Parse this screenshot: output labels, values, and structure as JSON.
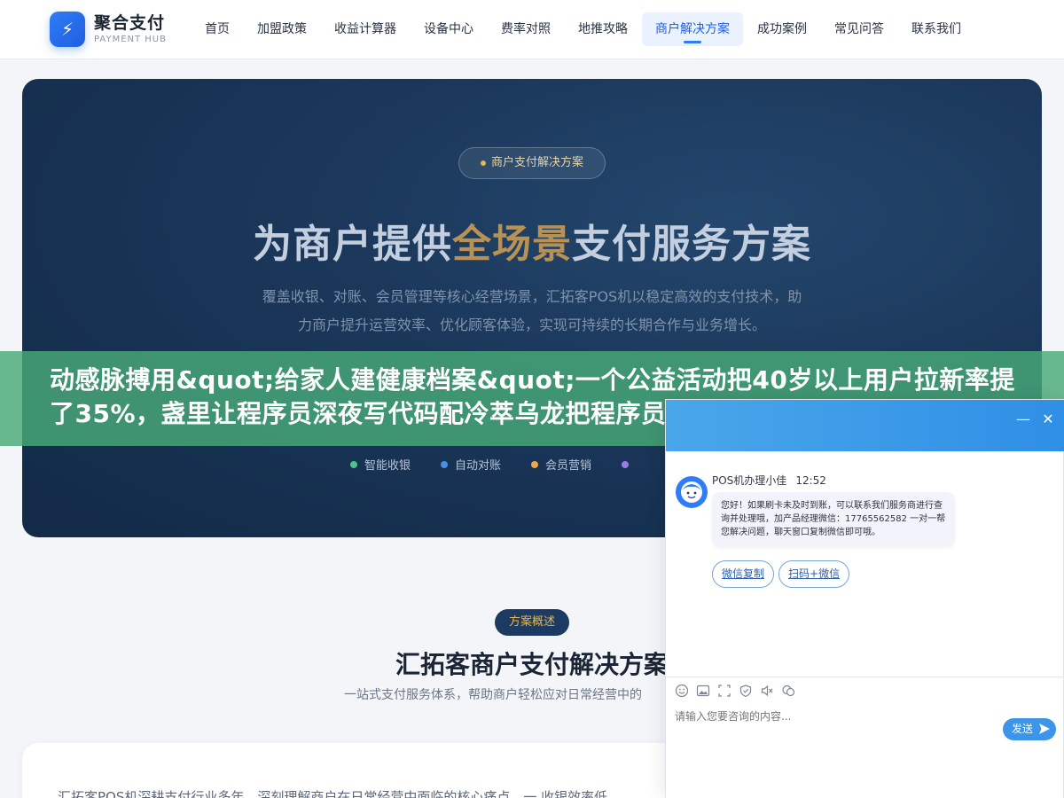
{
  "header": {
    "logo_title": "聚合支付",
    "logo_sub": "PAYMENT HUB",
    "nav": [
      "首页",
      "加盟政策",
      "收益计算器",
      "设备中心",
      "费率对照",
      "地推攻略",
      "商户解决方案",
      "成功案例",
      "常见问答",
      "联系我们"
    ],
    "active_index": 6
  },
  "hero": {
    "badge": "商户支付解决方案",
    "title_pre": "为商户提供",
    "title_highlight": "全场景",
    "title_post": "支付服务方案",
    "desc": "覆盖收银、对账、会员管理等核心经营场景，汇拓客POS机以稳定高效的支付技术，助力商户提升运营效率、优化顾客体验，实现可持续的长期合作与业务增长。",
    "tags": [
      {
        "label": "智能收银",
        "color": "#4cc38a"
      },
      {
        "label": "自动对账",
        "color": "#4a90e2"
      },
      {
        "label": "会员营销",
        "color": "#f0a54a"
      },
      {
        "label": "",
        "color": "#9b7be6"
      }
    ]
  },
  "overlay_banner": {
    "text": "动感脉搏用&quot;给家人建健康档案&quot;一个公益活动把40岁以上用户拉新率提了35%，盏里让程序员深夜写代码配冷萃乌龙把程序员套装销"
  },
  "section": {
    "pill": "方案概述",
    "title": "汇拓客商户支付解决方案",
    "subtitle": "一站式支付服务体系，帮助商户轻松应对日常经营中的",
    "content_text": "汇拓客POS机深耕支付行业多年，深刻理解商户在日常经营中面临的核心痛点，一 收银效率低"
  },
  "chat": {
    "agent_name": "POS机办理小佳",
    "time": "12:52",
    "message": "您好！如果刷卡未及时到账，可以联系我们服务商进行查询并处理哦，加产品经理微信：17765562582 一对一帮您解决问题，聊天窗口复制微信即可哦。",
    "actions": [
      "微信复制",
      "扫码+微信"
    ],
    "input_placeholder": "请输入您要咨询的内容...",
    "send_label": "发送",
    "minimize_label": "—",
    "close_label": "✕"
  }
}
